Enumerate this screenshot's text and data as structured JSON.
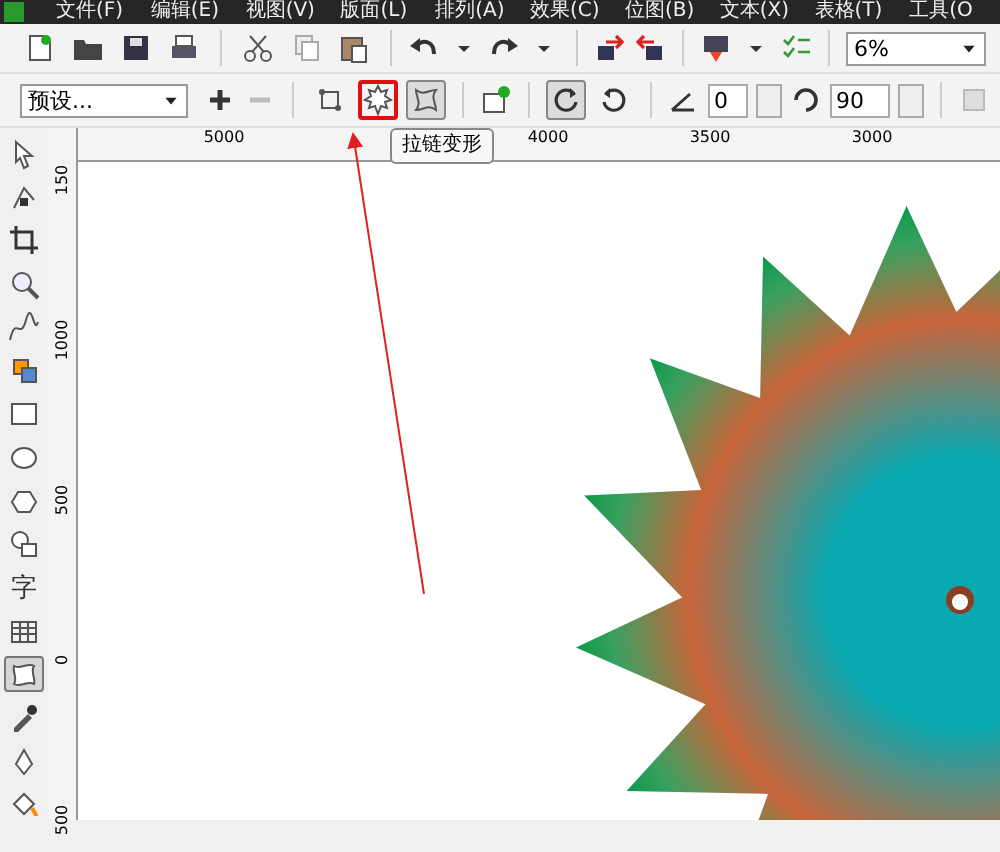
{
  "menu": [
    {
      "label": "文件(F)"
    },
    {
      "label": "编辑(E)"
    },
    {
      "label": "视图(V)"
    },
    {
      "label": "版面(L)"
    },
    {
      "label": "排列(A)"
    },
    {
      "label": "效果(C)"
    },
    {
      "label": "位图(B)"
    },
    {
      "label": "文本(X)"
    },
    {
      "label": "表格(T)"
    },
    {
      "label": "工具(O"
    }
  ],
  "toolbar": {
    "zoom": "6%"
  },
  "property_bar": {
    "preset": "预设...",
    "angle": "0",
    "rotation": "90",
    "distortions": [
      {
        "highlighted": false,
        "on": false
      },
      {
        "highlighted": true,
        "on": false
      },
      {
        "highlighted": false,
        "on": true
      }
    ],
    "direction": [
      {
        "on": true
      },
      {
        "on": false
      }
    ]
  },
  "tooltip": "拉链变形",
  "ruler": {
    "horizontal": [
      "5000",
      "4000",
      "3500",
      "3000"
    ],
    "vertical": [
      "150",
      "1000",
      "500",
      "0",
      "500"
    ]
  },
  "toolbox": [
    {
      "selected": false
    },
    {
      "selected": false
    },
    {
      "selected": false
    },
    {
      "selected": false
    },
    {
      "selected": false
    },
    {
      "selected": false
    },
    {
      "selected": false
    },
    {
      "selected": false
    },
    {
      "selected": false
    },
    {
      "selected": false
    },
    {
      "selected": false,
      "text": "字"
    },
    {
      "selected": false
    },
    {
      "selected": true
    },
    {
      "selected": false
    },
    {
      "selected": false
    },
    {
      "selected": false
    }
  ]
}
